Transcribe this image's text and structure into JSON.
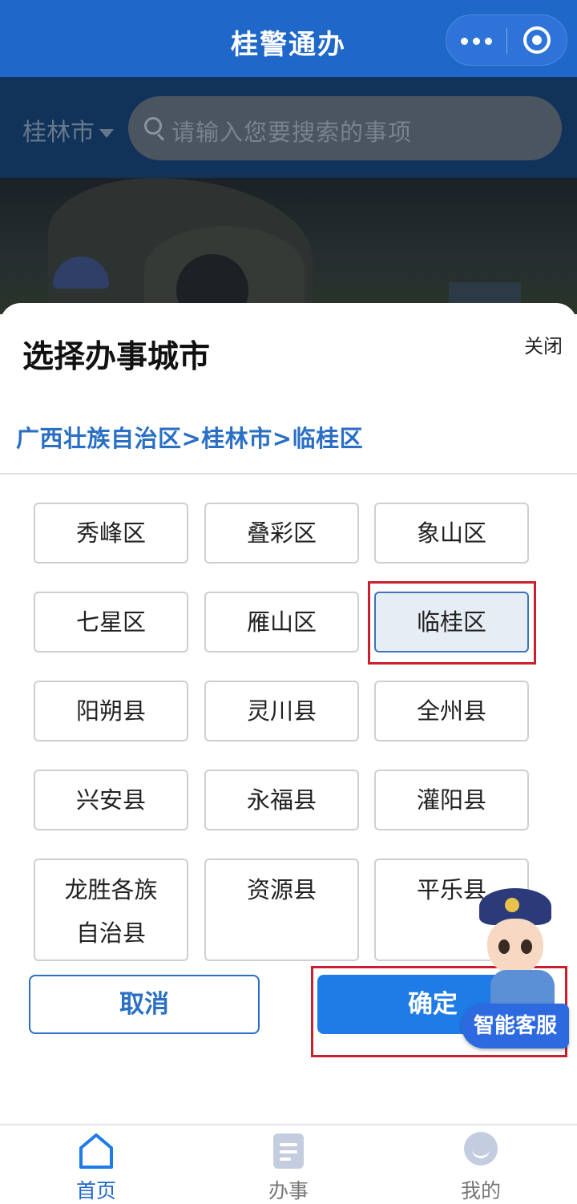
{
  "app": {
    "title": "桂警通办"
  },
  "capsule": {
    "more_icon": "more-dots-icon",
    "close_icon": "target-icon"
  },
  "search": {
    "city": "桂林市",
    "placeholder": "请输入您要搜索的事项"
  },
  "dialog": {
    "title": "选择办事城市",
    "close_label": "关闭",
    "breadcrumb": "广西壮族自治区>桂林市>临桂区",
    "selected": "临桂区",
    "options": [
      [
        "秀峰区",
        "叠彩区",
        "象山区"
      ],
      [
        "七星区",
        "雁山区",
        "临桂区"
      ],
      [
        "阳朔县",
        "灵川县",
        "全州县"
      ],
      [
        "兴安县",
        "永福县",
        "灌阳县"
      ],
      [
        "龙胜各族",
        "资源县",
        "平乐县"
      ]
    ],
    "option_line2": "自治县",
    "cancel_label": "取消",
    "confirm_label": "确定"
  },
  "assistant": {
    "label": "智能客服"
  },
  "tabbar": {
    "items": [
      {
        "label": "首页",
        "icon": "home-icon",
        "active": true
      },
      {
        "label": "办事",
        "icon": "document-icon",
        "active": false
      },
      {
        "label": "我的",
        "icon": "profile-icon",
        "active": false
      }
    ]
  },
  "colors": {
    "brand": "#1f67c8",
    "accent": "#2a6fc4",
    "highlight": "#c8202d"
  }
}
